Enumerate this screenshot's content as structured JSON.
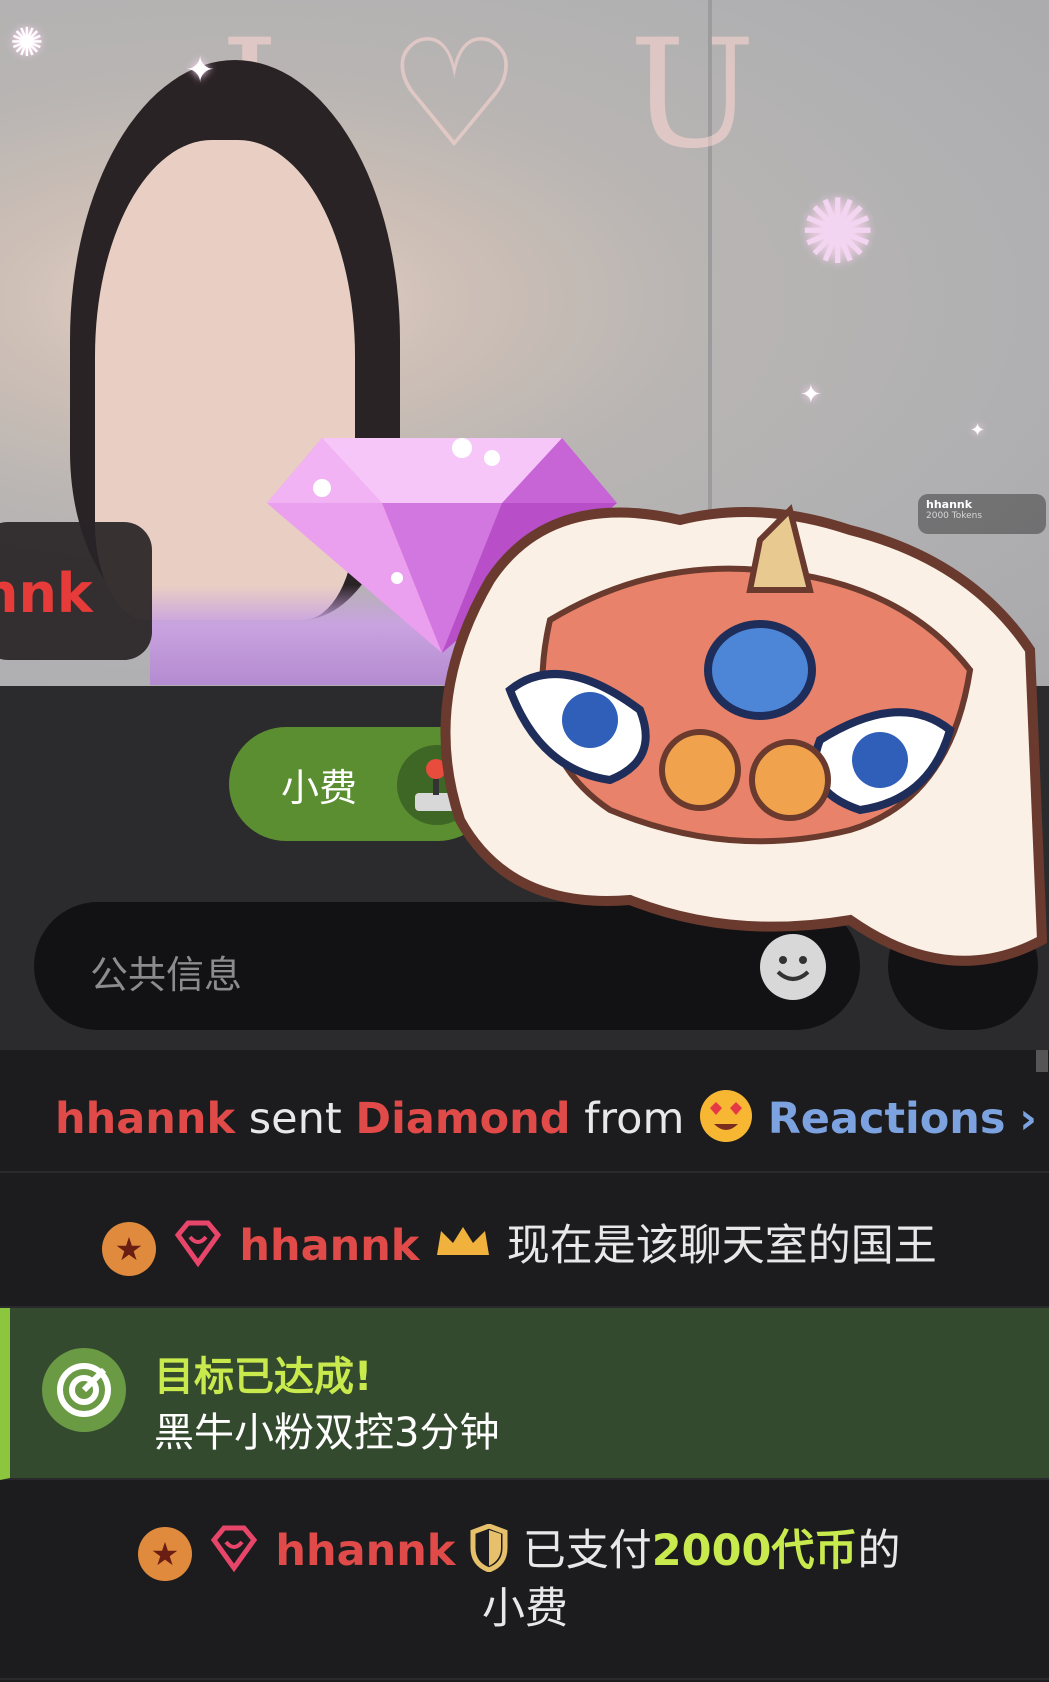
{
  "stream": {
    "overlay_text": "I ♡ U",
    "name_tag": "nnk",
    "tip_notice": {
      "user": "hhannk",
      "amount": "2000 Tokens"
    }
  },
  "controls": {
    "tip_button_label": "小费",
    "message_placeholder": "公共信息"
  },
  "chat": {
    "reaction": {
      "user": "hhannk",
      "sent": "sent",
      "gift": "Diamond",
      "from": "from",
      "source": "Reactions",
      "chevron": "›"
    },
    "king": {
      "user": "hhannk",
      "text": "现在是该聊天室的国王"
    },
    "goal": {
      "title": "目标已达成!",
      "description": "黑牛小粉双控3分钟"
    },
    "tip": {
      "user": "hhannk",
      "prefix": "已支付",
      "amount": "2000代币",
      "suffix": "的",
      "line2": "小费"
    }
  },
  "colors": {
    "accent_green": "#5b8d31",
    "user_red": "#e04b49",
    "reactions_blue": "#7da2e0",
    "goal_green": "#c8ea4c"
  },
  "icons": [
    "diamond-gift-icon",
    "lion-dance-mascot",
    "joystick-icon",
    "emoji-icon",
    "star-badge-icon",
    "diamond-badge-icon",
    "crown-icon",
    "target-icon",
    "shield-icon",
    "heart-eyes-emoji",
    "chevron-right-icon"
  ]
}
